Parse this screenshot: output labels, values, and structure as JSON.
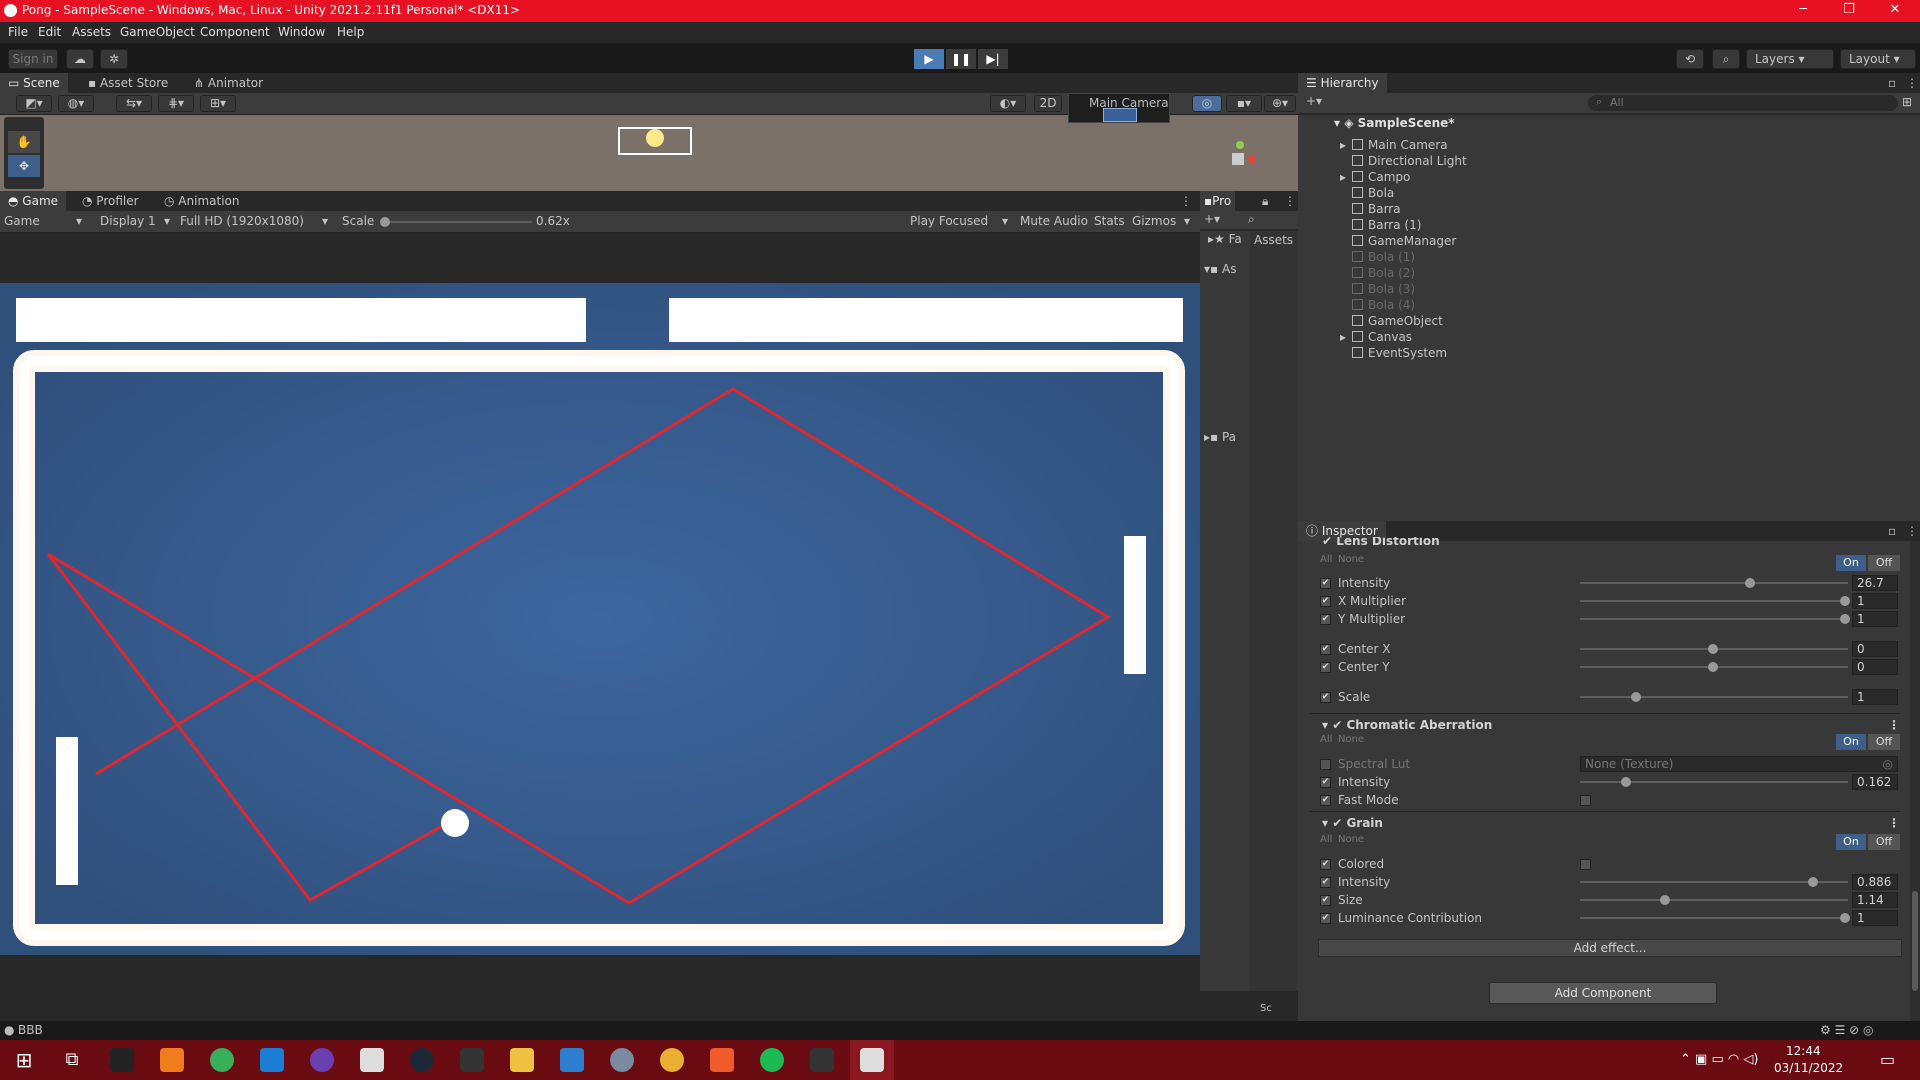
{
  "window": {
    "title": "Pong - SampleScene - Windows, Mac, Linux - Unity 2021.2.11f1 Personal* <DX11>",
    "minimize": "─",
    "maximize": "❐",
    "close": "✕"
  },
  "menu": [
    "File",
    "Edit",
    "Assets",
    "GameObject",
    "Component",
    "Window",
    "Help"
  ],
  "toolbar": {
    "sign_in": "Sign in",
    "layers": "Layers",
    "layout": "Layout"
  },
  "scene_tabs": {
    "scene": "Scene",
    "asset_store": "Asset Store",
    "animator": "Animator"
  },
  "scene_toolbar": {
    "mode_2d": "2D",
    "camera_label": "Main Camera"
  },
  "game_tabs": {
    "game": "Game",
    "profiler": "Profiler",
    "animation": "Animation"
  },
  "game_toolbar": {
    "view": "Game",
    "display": "Display 1",
    "resolution": "Full HD (1920x1080)",
    "scale_label": "Scale",
    "scale_value": "0.62x",
    "play_mode": "Play Focused",
    "mute": "Mute Audio",
    "stats": "Stats",
    "gizmos": "Gizmos"
  },
  "project": {
    "tab": "Pro",
    "assets": "Assets",
    "favorites": "Fa",
    "assets_short": "As",
    "packages": "Pa",
    "slider_label": "Sc"
  },
  "hierarchy": {
    "tab": "Hierarchy",
    "search_placeholder": "All",
    "scene": "SampleScene*",
    "items": [
      {
        "label": "Main Camera",
        "dim": false,
        "expand": true
      },
      {
        "label": "Directional Light",
        "dim": false,
        "expand": false
      },
      {
        "label": "Campo",
        "dim": false,
        "expand": true
      },
      {
        "label": "Bola",
        "dim": false,
        "expand": false
      },
      {
        "label": "Barra",
        "dim": false,
        "expand": false
      },
      {
        "label": "Barra (1)",
        "dim": false,
        "expand": false
      },
      {
        "label": "GameManager",
        "dim": false,
        "expand": false
      },
      {
        "label": "Bola (1)",
        "dim": true,
        "expand": false
      },
      {
        "label": "Bola (2)",
        "dim": true,
        "expand": false
      },
      {
        "label": "Bola (3)",
        "dim": true,
        "expand": false
      },
      {
        "label": "Bola (4)",
        "dim": true,
        "expand": false
      },
      {
        "label": "GameObject",
        "dim": false,
        "expand": false
      },
      {
        "label": "Canvas",
        "dim": false,
        "expand": true
      },
      {
        "label": "EventSystem",
        "dim": false,
        "expand": false
      }
    ]
  },
  "inspector": {
    "tab": "Inspector",
    "all": "All",
    "none": "None",
    "on": "On",
    "off": "Off",
    "lens": {
      "title": "Lens Distortion",
      "rows": [
        {
          "label": "Intensity",
          "value": "26.7",
          "level": 0.64
        },
        {
          "label": "X Multiplier",
          "value": "1",
          "level": 1.0
        },
        {
          "label": "Y Multiplier",
          "value": "1",
          "level": 1.0
        },
        {
          "label": "Center X",
          "value": "0",
          "level": 0.5
        },
        {
          "label": "Center Y",
          "value": "0",
          "level": 0.5
        },
        {
          "label": "Scale",
          "value": "1",
          "level": 0.21
        }
      ]
    },
    "chromatic": {
      "title": "Chromatic Aberration",
      "spectral_lut": "Spectral Lut",
      "lut_value": "None (Texture)",
      "intensity_label": "Intensity",
      "intensity_value": "0.162",
      "intensity_level": 0.17,
      "fast_mode": "Fast Mode"
    },
    "grain": {
      "title": "Grain",
      "colored": "Colored",
      "rows": [
        {
          "label": "Intensity",
          "value": "0.886",
          "level": 0.88
        },
        {
          "label": "Size",
          "value": "1.14",
          "level": 0.32
        },
        {
          "label": "Luminance Contribution",
          "value": "1",
          "level": 1.0
        }
      ]
    },
    "add_effect": "Add effect...",
    "add_component": "Add Component"
  },
  "status": {
    "text": "BBB"
  },
  "taskbar": {
    "time": "12:44",
    "date": "03/11/2022"
  }
}
